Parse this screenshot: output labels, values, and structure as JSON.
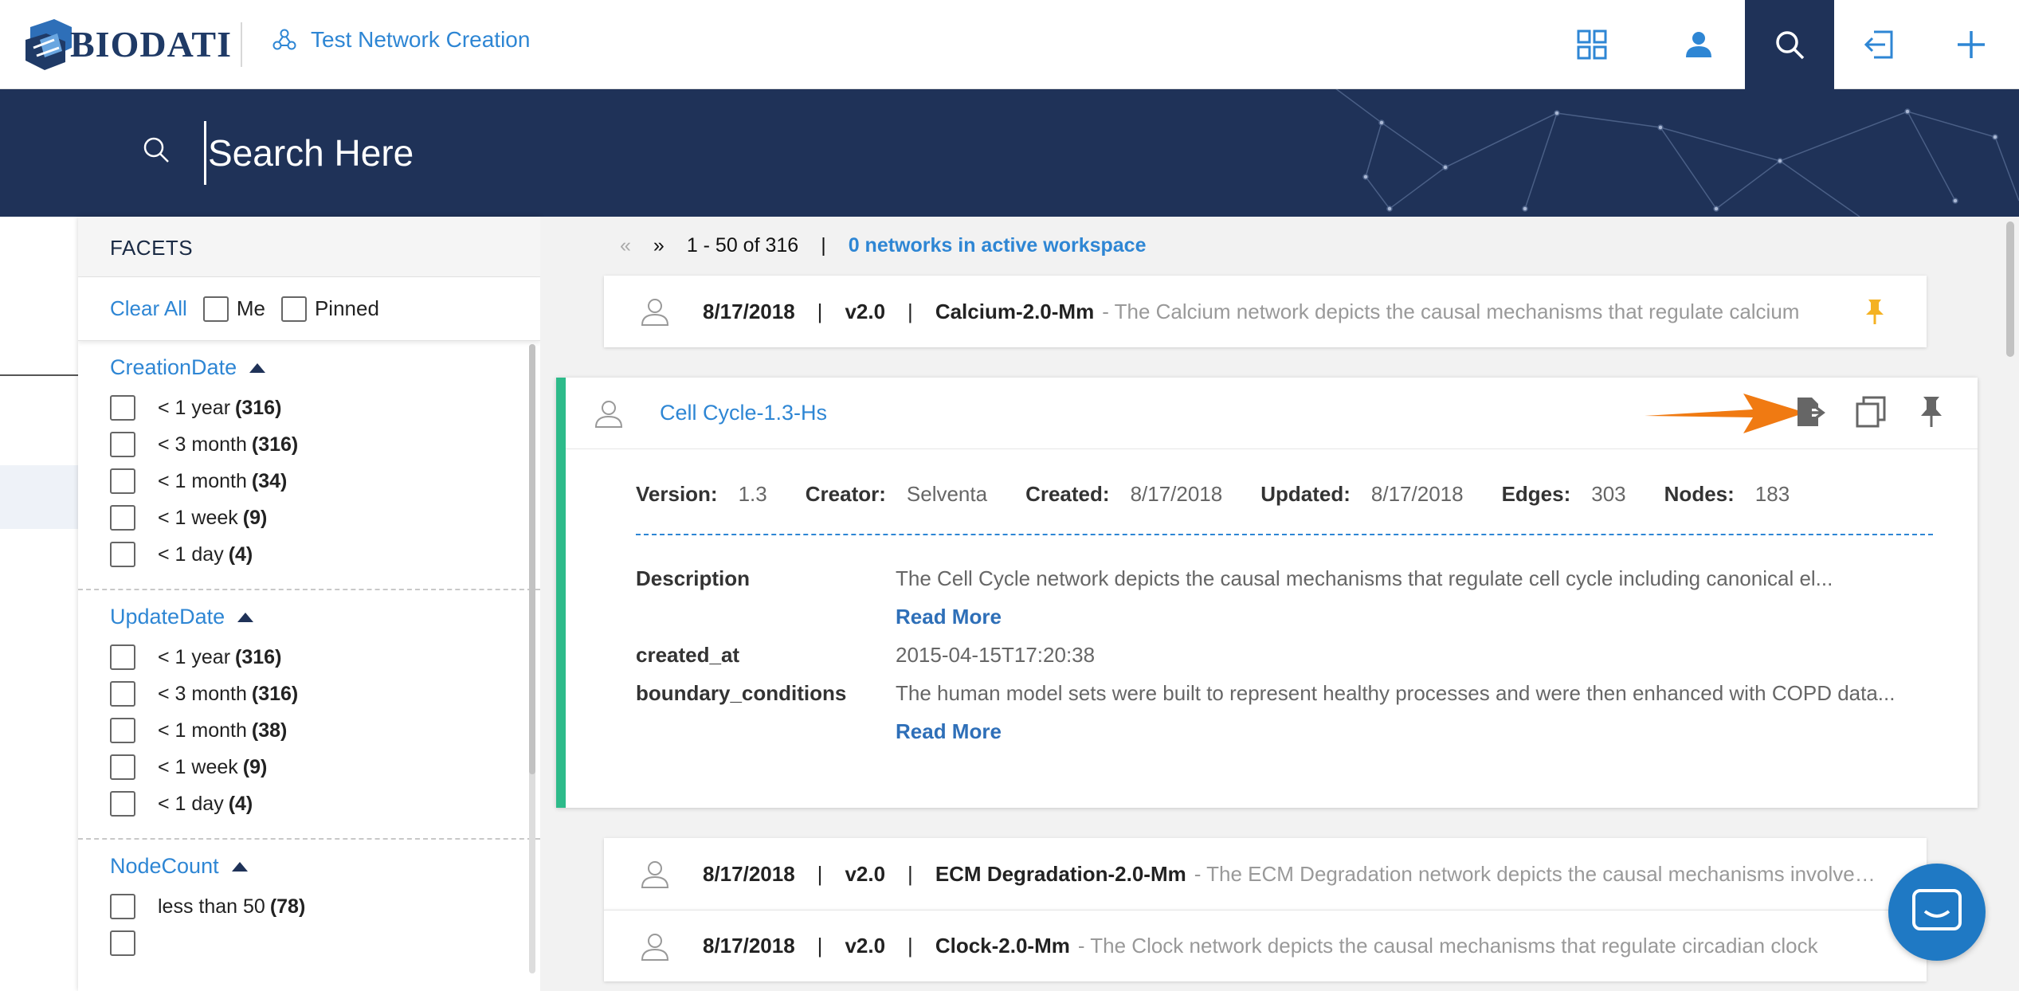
{
  "header": {
    "logo_text": "BIODATI",
    "network_title": "Test Network Creation",
    "icons": [
      "grid-icon",
      "user-icon",
      "search-icon",
      "sign-in-icon",
      "plus-icon"
    ]
  },
  "search": {
    "placeholder": "Search Here"
  },
  "facets": {
    "title": "FACETS",
    "clear_all": "Clear All",
    "me_label": "Me",
    "pinned_label": "Pinned",
    "groups": [
      {
        "title": "CreationDate",
        "items": [
          {
            "label": "< 1 year",
            "count": "(316)"
          },
          {
            "label": "< 3 month",
            "count": "(316)"
          },
          {
            "label": "< 1 month",
            "count": "(34)"
          },
          {
            "label": "< 1 week",
            "count": "(9)"
          },
          {
            "label": "< 1 day",
            "count": "(4)"
          }
        ]
      },
      {
        "title": "UpdateDate",
        "items": [
          {
            "label": "< 1 year",
            "count": "(316)"
          },
          {
            "label": "< 3 month",
            "count": "(316)"
          },
          {
            "label": "< 1 month",
            "count": "(38)"
          },
          {
            "label": "< 1 week",
            "count": "(9)"
          },
          {
            "label": "< 1 day",
            "count": "(4)"
          }
        ]
      },
      {
        "title": "NodeCount",
        "items": [
          {
            "label": "less than 50",
            "count": "(78)"
          }
        ]
      }
    ]
  },
  "pager": {
    "prev": "«",
    "next": "»",
    "range": "1 - 50 of 316",
    "sep": "|",
    "workspace": "0 networks in active workspace"
  },
  "rows": [
    {
      "date": "8/17/2018",
      "version": "v2.0",
      "name": "Calcium-2.0-Mm",
      "desc": "- The Calcium network depicts the causal mechanisms that regulate calcium",
      "pinned": true
    },
    {
      "date": "8/17/2018",
      "version": "v2.0",
      "name": "ECM Degradation-2.0-Mm",
      "desc": "- The ECM Degradation network depicts the causal mechanisms involved in ECM degradation",
      "pinned": false
    },
    {
      "date": "8/17/2018",
      "version": "v2.0",
      "name": "Clock-2.0-Mm",
      "desc": "- The Clock network depicts the causal mechanisms that regulate circadian clock",
      "pinned": false
    }
  ],
  "expanded": {
    "name": "Cell Cycle-1.3-Hs",
    "meta": {
      "version_k": "Version:",
      "version_v": "1.3",
      "creator_k": "Creator:",
      "creator_v": "Selventa",
      "created_k": "Created:",
      "created_v": "8/17/2018",
      "updated_k": "Updated:",
      "updated_v": "8/17/2018",
      "edges_k": "Edges:",
      "edges_v": "303",
      "nodes_k": "Nodes:",
      "nodes_v": "183"
    },
    "description_k": "Description",
    "description_v": "The Cell Cycle network depicts the causal mechanisms that regulate cell cycle including canonical el...",
    "read_more": "Read More",
    "created_at_k": "created_at",
    "created_at_v": "2015-04-15T17:20:38",
    "boundary_k": "boundary_conditions",
    "boundary_v": "The human model sets were built to represent healthy processes and were then enhanced with COPD data...",
    "actions": [
      "export-icon",
      "copy-icon",
      "pin-icon"
    ]
  },
  "colors": {
    "navy": "#1f3258",
    "link_blue": "#2e86d4",
    "accent_green": "#2dbb8a",
    "pin_gold": "#f4b223",
    "arrow_orange": "#f07a12"
  }
}
